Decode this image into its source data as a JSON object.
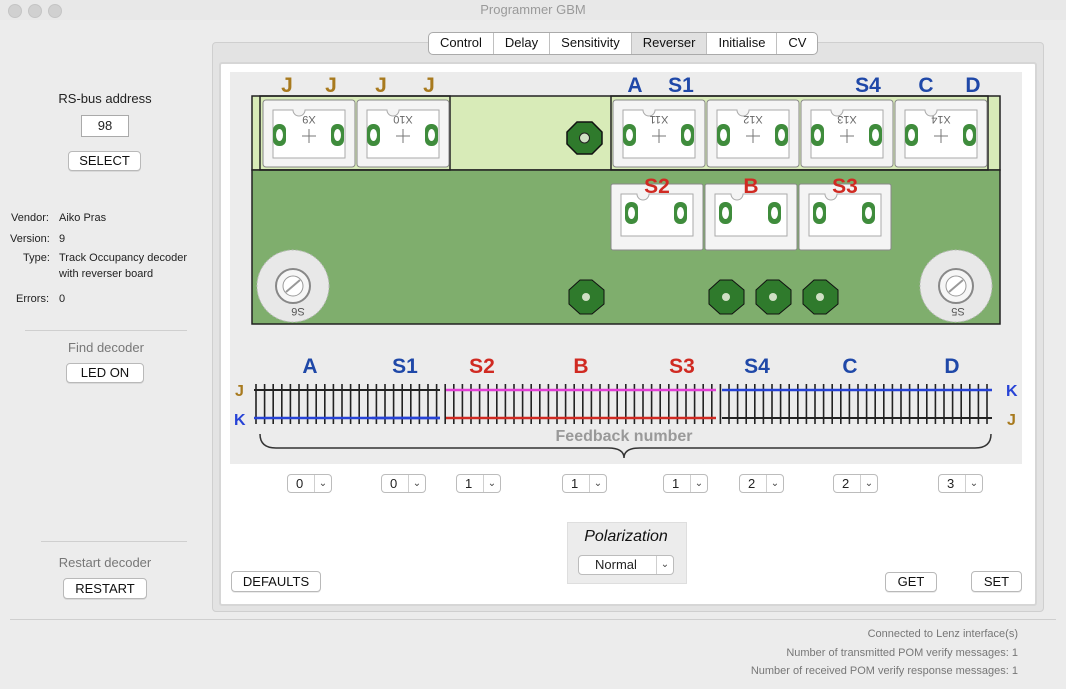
{
  "window": {
    "title": "Programmer GBM"
  },
  "tabs": [
    {
      "label": "Control"
    },
    {
      "label": "Delay"
    },
    {
      "label": "Sensitivity"
    },
    {
      "label": "Reverser",
      "active": true
    },
    {
      "label": "Initialise"
    },
    {
      "label": "CV"
    }
  ],
  "sidebar": {
    "rs_bus_label": "RS-bus address",
    "rs_bus_value": "98",
    "select_button": "SELECT",
    "vendor_label": "Vendor:",
    "vendor_value": "Aiko Pras",
    "version_label": "Version:",
    "version_value": "9",
    "type_label": "Type:",
    "type_value_line1": "Track Occupancy decoder",
    "type_value_line2": "with reverser board",
    "errors_label": "Errors:",
    "errors_value": "0",
    "find_decoder_label": "Find decoder",
    "led_on_button": "LED ON",
    "restart_label": "Restart decoder",
    "restart_button": "RESTART"
  },
  "board": {
    "top_labels_j": [
      "J",
      "J",
      "J",
      "J"
    ],
    "top_labels": [
      "A",
      "S1",
      "S4",
      "C",
      "D"
    ],
    "mid_labels": [
      "S2",
      "B",
      "S3"
    ],
    "connector_labels": [
      "X9",
      "X10",
      "X11",
      "X12",
      "X13",
      "X14"
    ],
    "corner_labels": [
      "S6",
      "S5"
    ]
  },
  "track": {
    "section_labels": [
      "A",
      "S1",
      "S2",
      "B",
      "S3",
      "S4",
      "C",
      "D"
    ],
    "left_top": "J",
    "left_bottom": "K",
    "right_top": "K",
    "right_bottom": "J",
    "feedback_label": "Feedback number"
  },
  "feedback_selects": [
    {
      "value": "0"
    },
    {
      "value": "0"
    },
    {
      "value": "1"
    },
    {
      "value": "1"
    },
    {
      "value": "1"
    },
    {
      "value": "2"
    },
    {
      "value": "2"
    },
    {
      "value": "3"
    }
  ],
  "polarization": {
    "label": "Polarization",
    "value": "Normal"
  },
  "buttons": {
    "defaults": "DEFAULTS",
    "get": "GET",
    "set": "SET"
  },
  "status": {
    "line1": "Connected to Lenz interface(s)",
    "line2": "Number of transmitted POM verify messages: 1",
    "line3": "Number of received POM verify response messages: 1"
  },
  "colors": {
    "blue": "#1f48a8",
    "red": "#d02a22",
    "gold": "#a87a1e",
    "pcb": "#7fae6d",
    "pcb_light": "#d8ebb8"
  }
}
